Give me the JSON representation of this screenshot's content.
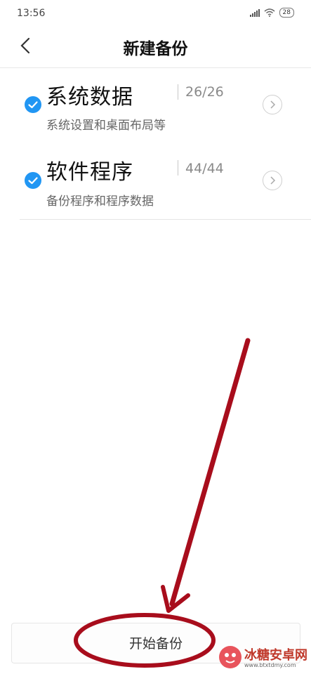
{
  "status_bar": {
    "time": "13:56",
    "battery": "28"
  },
  "header": {
    "title": "新建备份"
  },
  "items": [
    {
      "title": "系统数据",
      "count": "26/26",
      "subtitle": "系统设置和桌面布局等",
      "checked": true
    },
    {
      "title": "软件程序",
      "count": "44/44",
      "subtitle": "备份程序和程序数据",
      "checked": true
    }
  ],
  "footer": {
    "start_label": "开始备份"
  },
  "watermark": {
    "title": "冰糖安卓网",
    "url": "www.btxtdmy.com"
  },
  "colors": {
    "accent": "#2196f3",
    "annotation": "#a80d1c"
  }
}
